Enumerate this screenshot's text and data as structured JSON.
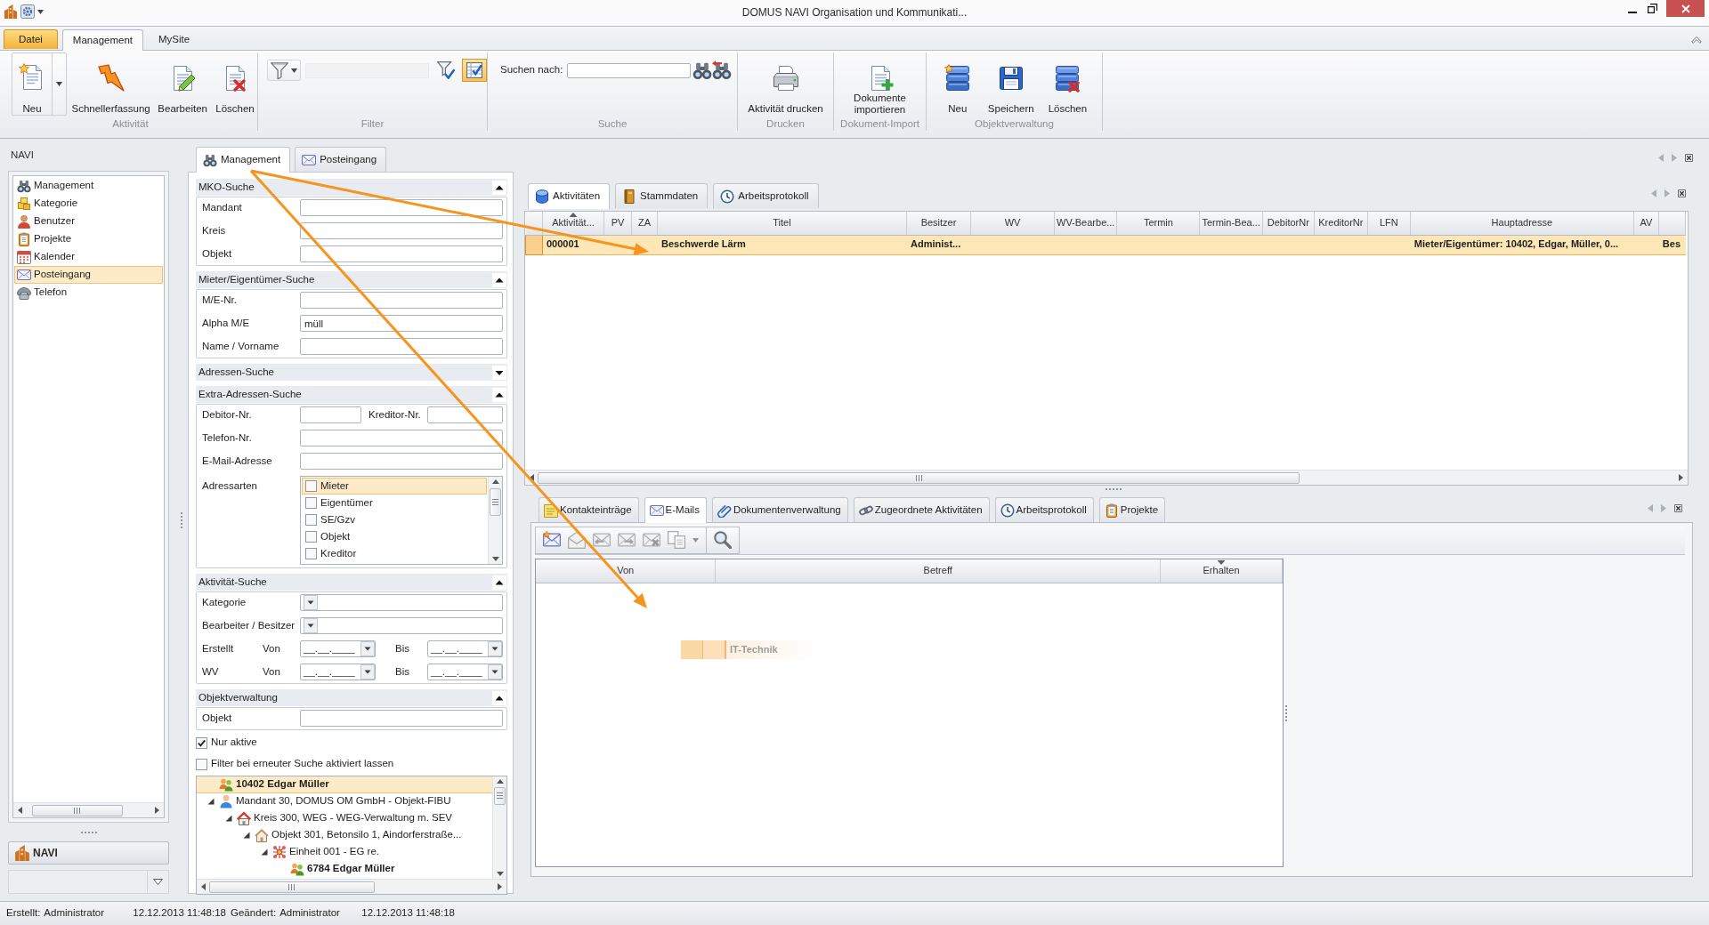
{
  "window": {
    "title": "DOMUS NAVI Organisation und Kommunikati..."
  },
  "ribbon": {
    "tabs": [
      {
        "label": "Datei",
        "kind": "file",
        "selected": false
      },
      {
        "label": "Management",
        "kind": "tab",
        "selected": true
      },
      {
        "label": "MySite",
        "kind": "tab",
        "selected": false
      }
    ],
    "groups": [
      {
        "label": "Aktivität",
        "items": [
          {
            "kind": "split",
            "label": "Neu"
          },
          {
            "kind": "large",
            "label": "Schnellerfassung"
          },
          {
            "kind": "large",
            "label": "Bearbeiten"
          },
          {
            "kind": "large",
            "label": "Löschen"
          }
        ]
      },
      {
        "label": "Filter",
        "items": [
          {
            "kind": "menu"
          },
          {
            "kind": "combo",
            "disabled": true
          },
          {
            "kind": "toggle",
            "pressed": false
          },
          {
            "kind": "toggle",
            "pressed": true
          }
        ]
      },
      {
        "label": "Suche",
        "items": [
          {
            "kind": "search",
            "label": "Suchen nach:"
          },
          {
            "kind": "small"
          },
          {
            "kind": "small"
          }
        ]
      },
      {
        "label": "Drucken",
        "items": [
          {
            "kind": "large",
            "label": "Aktivität drucken"
          }
        ]
      },
      {
        "label": "Dokument-Import",
        "items": [
          {
            "kind": "large",
            "label": "Dokumente importieren"
          }
        ]
      },
      {
        "label": "Objektverwaltung",
        "items": [
          {
            "kind": "large",
            "label": "Neu"
          },
          {
            "kind": "large",
            "label": "Speichern"
          },
          {
            "kind": "large",
            "label": "Löschen"
          }
        ]
      }
    ]
  },
  "navigation": {
    "title": "NAVI",
    "items": [
      {
        "label": "Management",
        "selected": false
      },
      {
        "label": "Kategorie",
        "selected": false
      },
      {
        "label": "Benutzer",
        "selected": false
      },
      {
        "label": "Projekte",
        "selected": false
      },
      {
        "label": "Kalender",
        "selected": false
      },
      {
        "label": "Posteingang",
        "selected": true
      },
      {
        "label": "Telefon",
        "selected": false
      }
    ],
    "footer_button": "NAVI"
  },
  "document_tabs": [
    {
      "label": "Management",
      "selected": true
    },
    {
      "label": "Posteingang",
      "selected": false
    }
  ],
  "search_form": {
    "sections": [
      {
        "title": "MKO-Suche",
        "expanded": true,
        "fields": [
          {
            "kind": "text",
            "label": "Mandant"
          },
          {
            "kind": "text",
            "label": "Kreis"
          },
          {
            "kind": "text",
            "label": "Objekt"
          }
        ]
      },
      {
        "title": "Mieter/Eigentümer-Suche",
        "expanded": true,
        "fields": [
          {
            "kind": "text",
            "label": "M/E-Nr."
          },
          {
            "kind": "text",
            "label": "Alpha M/E",
            "value": "müll"
          },
          {
            "kind": "text",
            "label": "Name / Vorname"
          }
        ]
      },
      {
        "title": "Adressen-Suche",
        "expanded": false
      },
      {
        "title": "Extra-Adressen-Suche",
        "expanded": true,
        "fields": [
          {
            "kind": "pair",
            "label": "Debitor-Nr.",
            "second_label": "Kreditor-Nr."
          },
          {
            "kind": "text",
            "label": "Telefon-Nr."
          },
          {
            "kind": "text",
            "label": "E-Mail-Adresse"
          },
          {
            "kind": "checklist",
            "label": "Adressarten",
            "options": [
              {
                "label": "Mieter",
                "checked": false,
                "selected": true
              },
              {
                "label": "Eigentümer",
                "checked": false,
                "selected": false
              },
              {
                "label": "SE/Gzv",
                "checked": false,
                "selected": false
              },
              {
                "label": "Objekt",
                "checked": false,
                "selected": false
              },
              {
                "label": "Kreditor",
                "checked": false,
                "selected": false
              }
            ]
          }
        ]
      },
      {
        "title": "Aktivität-Suche",
        "expanded": true,
        "fields": [
          {
            "kind": "combo",
            "label": "Kategorie"
          },
          {
            "kind": "combo",
            "label": "Bearbeiter / Besitzer"
          },
          {
            "kind": "dates",
            "label": "Erstellt",
            "from_label": "Von",
            "from_value": "__.__.____",
            "to_label": "Bis",
            "to_value": "__.__.____"
          },
          {
            "kind": "dates",
            "label": "WV",
            "from_label": "Von",
            "from_value": "__.__.____",
            "to_label": "Bis",
            "to_value": "__.__.____"
          }
        ]
      },
      {
        "title": "Objektverwaltung",
        "expanded": true,
        "fields": [
          {
            "kind": "text",
            "label": "Objekt"
          }
        ]
      }
    ],
    "options": [
      {
        "label": "Nur aktive",
        "checked": true
      },
      {
        "label": "Filter bei erneuter Suche aktiviert lassen",
        "checked": false
      }
    ],
    "tree": [
      {
        "kind": "person",
        "label": "10402 Edgar Müller",
        "selected": true
      },
      {
        "kind": "client",
        "label": "Mandant 30, DOMUS OM GmbH - Objekt-FIBU",
        "selected": false,
        "expanded": true,
        "children": [
          {
            "kind": "district",
            "label": "Kreis 300, WEG - WEG-Verwaltung m. SEV",
            "selected": false,
            "expanded": true,
            "children": [
              {
                "kind": "property",
                "label": "Objekt 301, Betonsilo 1, Aindorferstraße...",
                "selected": false,
                "expanded": true,
                "children": [
                  {
                    "kind": "unit",
                    "label": "Einheit 001 - EG re.",
                    "selected": false,
                    "expanded": true,
                    "children": [
                      {
                        "kind": "person",
                        "label": "6784 Edgar Müller",
                        "selected": false
                      }
                    ]
                  }
                ]
              }
            ]
          }
        ]
      }
    ]
  },
  "activities": {
    "tabs": [
      {
        "label": "Aktivitäten",
        "selected": true
      },
      {
        "label": "Stammdaten",
        "selected": false
      },
      {
        "label": "Arbeitsprotokoll",
        "selected": false
      }
    ],
    "columns": [
      {
        "label": "Aktivität...",
        "sorted": true,
        "descending": false
      },
      {
        "label": "PV",
        "sorted": false
      },
      {
        "label": "ZA",
        "sorted": false
      },
      {
        "label": "Titel",
        "sorted": false
      },
      {
        "label": "Besitzer",
        "sorted": false
      },
      {
        "label": "WV",
        "sorted": false
      },
      {
        "label": "WV-Bearbe...",
        "sorted": false
      },
      {
        "label": "Termin",
        "sorted": false
      },
      {
        "label": "Termin-Bea...",
        "sorted": false
      },
      {
        "label": "DebitorNr",
        "sorted": false
      },
      {
        "label": "KreditorNr",
        "sorted": false
      },
      {
        "label": "LFN",
        "sorted": false
      },
      {
        "label": "Hauptadresse",
        "sorted": false
      },
      {
        "label": "AV",
        "sorted": false
      }
    ],
    "rows": [
      {
        "selected": true,
        "cells": [
          "000001",
          null,
          null,
          "Beschwerde Lärm",
          "Administ...",
          null,
          null,
          null,
          null,
          null,
          null,
          null,
          "Mieter/Eigentümer: 10402, Edgar, Müller, 0...",
          null,
          "Bes"
        ]
      }
    ]
  },
  "details": {
    "tabs": [
      {
        "label": "Kontakteinträge",
        "selected": false
      },
      {
        "label": "E-Mails",
        "selected": true
      },
      {
        "label": "Dokumentenverwaltung",
        "selected": false
      },
      {
        "label": "Zugeordnete Aktivitäten",
        "selected": false
      },
      {
        "label": "Arbeitsprotokoll",
        "selected": false
      },
      {
        "label": "Projekte",
        "selected": false
      }
    ],
    "toolbar": [
      {
        "kind": "button",
        "disabled": false
      },
      {
        "kind": "button",
        "disabled": true
      },
      {
        "kind": "button",
        "disabled": true
      },
      {
        "kind": "button",
        "disabled": true
      },
      {
        "kind": "button",
        "disabled": true
      },
      {
        "kind": "split",
        "disabled": true
      },
      {
        "kind": "button",
        "disabled": false
      }
    ],
    "columns": [
      {
        "label": "Von",
        "sorted": false
      },
      {
        "label": "Betreff",
        "sorted": false
      },
      {
        "label": "Erhalten",
        "sorted": true,
        "descending": true
      }
    ],
    "drag_preview": {
      "label": "IT-Technik"
    }
  },
  "status_bar": [
    {
      "label": "Erstellt:",
      "user": "Administrator",
      "time": "12.12.2013 11:48:18"
    },
    {
      "label": "Geändert:",
      "user": "Administrator",
      "time": "12.12.2013 11:48:18"
    }
  ]
}
